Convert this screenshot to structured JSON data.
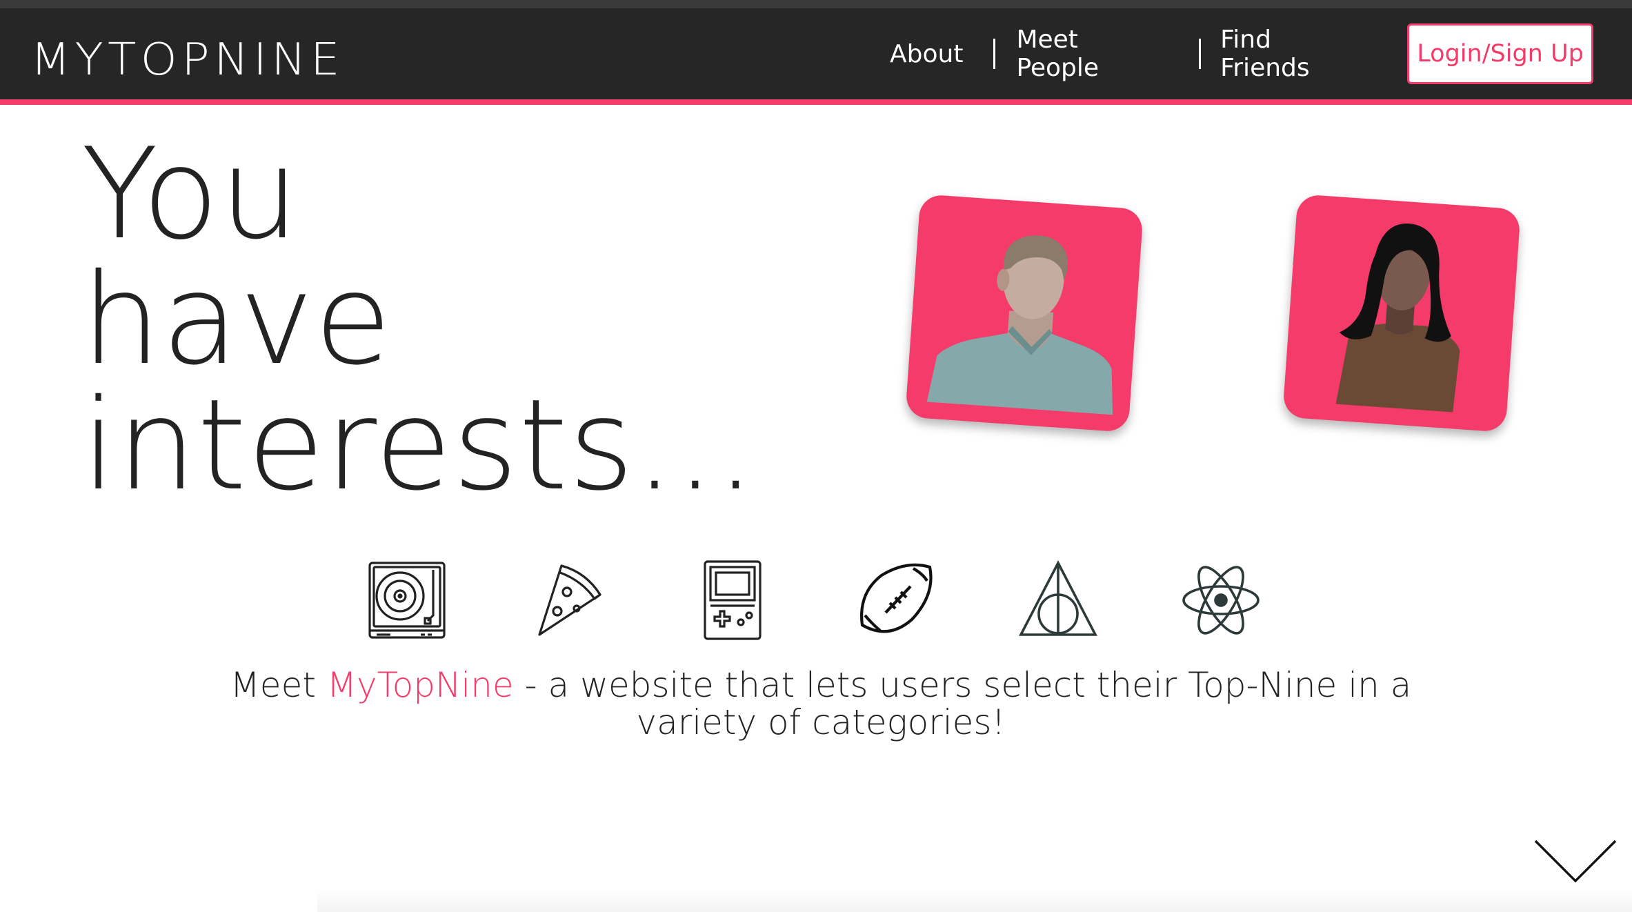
{
  "brand": {
    "logo": "MYTOPNINE",
    "accent_color": "#f53b6a",
    "nav_bg": "#262626"
  },
  "nav": {
    "links": [
      "About",
      "Meet People",
      "Find Friends"
    ],
    "login": "Login/Sign Up"
  },
  "hero": {
    "headline_lines": [
      "You",
      "have",
      "interests..."
    ],
    "avatars": [
      "male-avatar-icon",
      "female-avatar-icon"
    ]
  },
  "interests": {
    "icons": [
      "turntable-icon",
      "pizza-icon",
      "gameboy-icon",
      "football-icon",
      "deathly-hallows-icon",
      "atom-icon"
    ]
  },
  "tagline": {
    "prefix": "Meet ",
    "brand": "MyTopNine",
    "suffix": " - a website that lets users select their Top-Nine in a variety of categories!"
  },
  "scroll": {
    "icon": "chevron-down-icon"
  }
}
